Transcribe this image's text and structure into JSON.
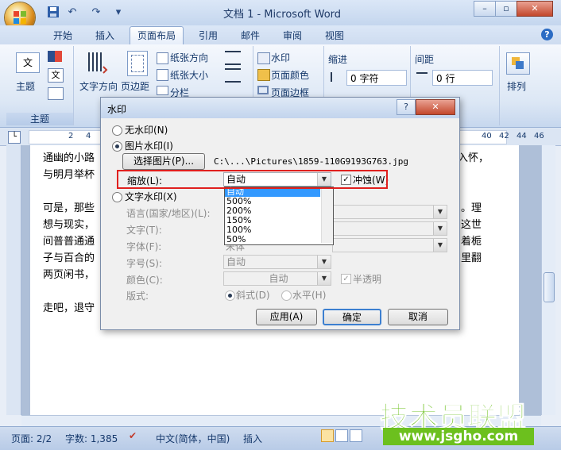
{
  "window": {
    "title": "文档 1 - Microsoft Word",
    "minimize": "–",
    "restore": "▫",
    "close": "✕"
  },
  "qat": {
    "save": "💾",
    "undo": "↶",
    "redo": "↷",
    "more": "▾"
  },
  "tabs": [
    {
      "label": "开始"
    },
    {
      "label": "插入"
    },
    {
      "label": "页面布局"
    },
    {
      "label": "引用"
    },
    {
      "label": "邮件"
    },
    {
      "label": "审阅"
    },
    {
      "label": "视图"
    }
  ],
  "help": "?",
  "ribbon": {
    "theme_label": "主题",
    "theme_group": "主题",
    "text_direction": "文字方向",
    "margins": "页边距",
    "orientation": "纸张方向",
    "size": "纸张大小",
    "columns": "分栏",
    "watermark": "水印",
    "page_color": "页面颜色",
    "page_borders": "页面边框",
    "indent_label": "缩进",
    "indent_value": "0 字符",
    "spacing_label": "间距",
    "spacing_value": "0 行",
    "arrange": "排列"
  },
  "ruler": {
    "t2": "2",
    "t4": "4",
    "t40": "40",
    "t42": "42",
    "t44": "44",
    "t46": "46"
  },
  "document": {
    "l1a": "通幽的小路",
    "l1b": "入怀，",
    "l2": "与明月举杯",
    "l3a": "可是，那些",
    "l3b": "。理",
    "l4a": "想与现实，",
    "l4b": "这世",
    "l5a": "间普普通通",
    "l5b": "着栀",
    "l6a": "子与百合的",
    "l6b": "里翻",
    "l7": "两页闲书，",
    "l8": "走吧，退守"
  },
  "dialog": {
    "title": "水印",
    "help": "?",
    "close": "✕",
    "no_watermark": "无水印(N)",
    "picture_watermark": "图片水印(I)",
    "select_picture": "选择图片(P)...",
    "picture_path": "C:\\...\\Pictures\\1859-110G9193G763.jpg",
    "scale_label": "缩放(L):",
    "scale_value": "自动",
    "washout": "冲蚀(W)",
    "washout_check": "✓",
    "scale_options": [
      "自动",
      "500%",
      "200%",
      "150%",
      "100%",
      "50%"
    ],
    "text_watermark": "文字水印(X)",
    "language_label": "语言(国家/地区)(L):",
    "text_label": "文字(T):",
    "font_label": "字体(F):",
    "font_value": "宋体",
    "size_label": "字号(S):",
    "size_value": "自动",
    "color_label": "颜色(C):",
    "color_value": "自动",
    "semi_transparent": "半透明",
    "layout_label": "版式:",
    "diagonal": "斜式(D)",
    "horizontal": "水平(H)",
    "apply": "应用(A)",
    "ok": "确定",
    "cancel": "取消"
  },
  "status": {
    "page": "页面: 2/2",
    "words": "字数: 1,385",
    "language": "中文(简体，中国)",
    "mode": "插入"
  },
  "watermark_site": {
    "name": "技术员联盟",
    "url": "www.jsgho.com"
  }
}
